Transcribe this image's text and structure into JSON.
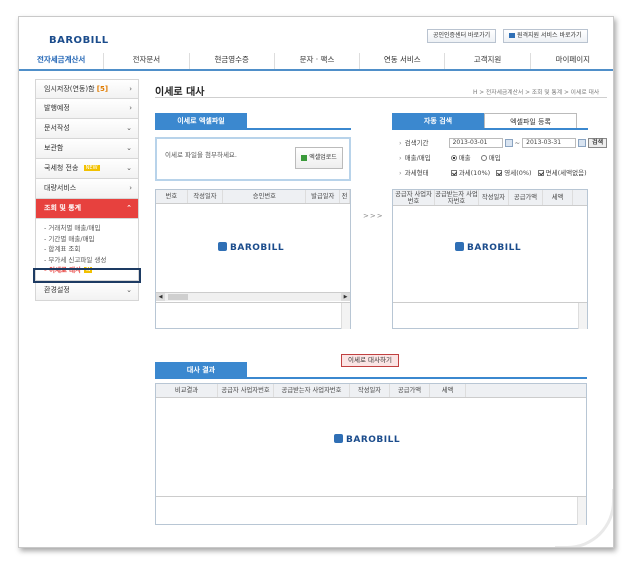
{
  "header": {
    "logo": "BAROBILL",
    "top_buttons": [
      "공인인증센터 바로가기",
      "원격지원 서비스 바로가기"
    ]
  },
  "nav": [
    "전자세금계산서",
    "전자문서",
    "현금영수증",
    "문자 · 팩스",
    "연동 서비스",
    "고객지원",
    "마이페이지"
  ],
  "sidebar": {
    "items": [
      {
        "label": "임시저장(연동)함",
        "count": "[5]"
      },
      {
        "label": "발행예정"
      },
      {
        "label": "문서작성"
      },
      {
        "label": "보관함"
      },
      {
        "label": "국세청 전송",
        "badge": "NEW"
      },
      {
        "label": "대량서비스"
      },
      {
        "label": "조회 및 통계"
      },
      {
        "label": "환경설정"
      }
    ],
    "sub_items": [
      "- 거래처별 매출/매입",
      "- 기간별 매출/매입",
      "- 합계표 조회",
      "- 부가세 신고파일 생성",
      "- 이세로 대사"
    ],
    "sub_new_badge": "N",
    "chevron_down": "⌄",
    "chevron_right": "›",
    "chevron_up": "⌃"
  },
  "page": {
    "title": "이세로 대사",
    "breadcrumb": "H > 전자세금계산서 > 조회 및 통계 > 이세로 대사"
  },
  "upload": {
    "tab": "이세로 엑셀파일",
    "hint": "이세로 파일을 첨부하세요.",
    "button": "엑셀업로드"
  },
  "left_grid": {
    "columns": [
      "번호",
      "작성일자",
      "승인번호",
      "발급일자",
      "전"
    ]
  },
  "right": {
    "tabs": [
      "자동 검색",
      "엑셀파일 등록"
    ],
    "period_label": "검색기간",
    "date_from": "2013-03-01",
    "date_to": "2013-03-31",
    "date_sep": "~",
    "search_button": "검색",
    "sales_label": "매출/매입",
    "sales_options": [
      "매출",
      "매입"
    ],
    "tax_label": "과세형태",
    "tax_options": [
      "과세(10%)",
      "영세(0%)",
      "면세(세액없음)"
    ],
    "columns": [
      "공급자 사업자번호",
      "공급받는자 사업자번호",
      "작성일자",
      "공급가액",
      "세액"
    ]
  },
  "arrows": ">>>",
  "compare_button": "이세로 대사하기",
  "result": {
    "tab": "대사 결과",
    "columns": [
      "비교결과",
      "공급자 사업자번호",
      "공급받는자 사업자번호",
      "작성일자",
      "공급가액",
      "세액"
    ]
  },
  "watermark": "BAROBILL",
  "scroll_glyphs": {
    "left": "◀",
    "right": "▶",
    "up": "⌃",
    "down": "⌄"
  },
  "colors": {
    "accent": "#3b88cf",
    "menu_active": "#e7413e",
    "brand": "#1b4c8c"
  }
}
